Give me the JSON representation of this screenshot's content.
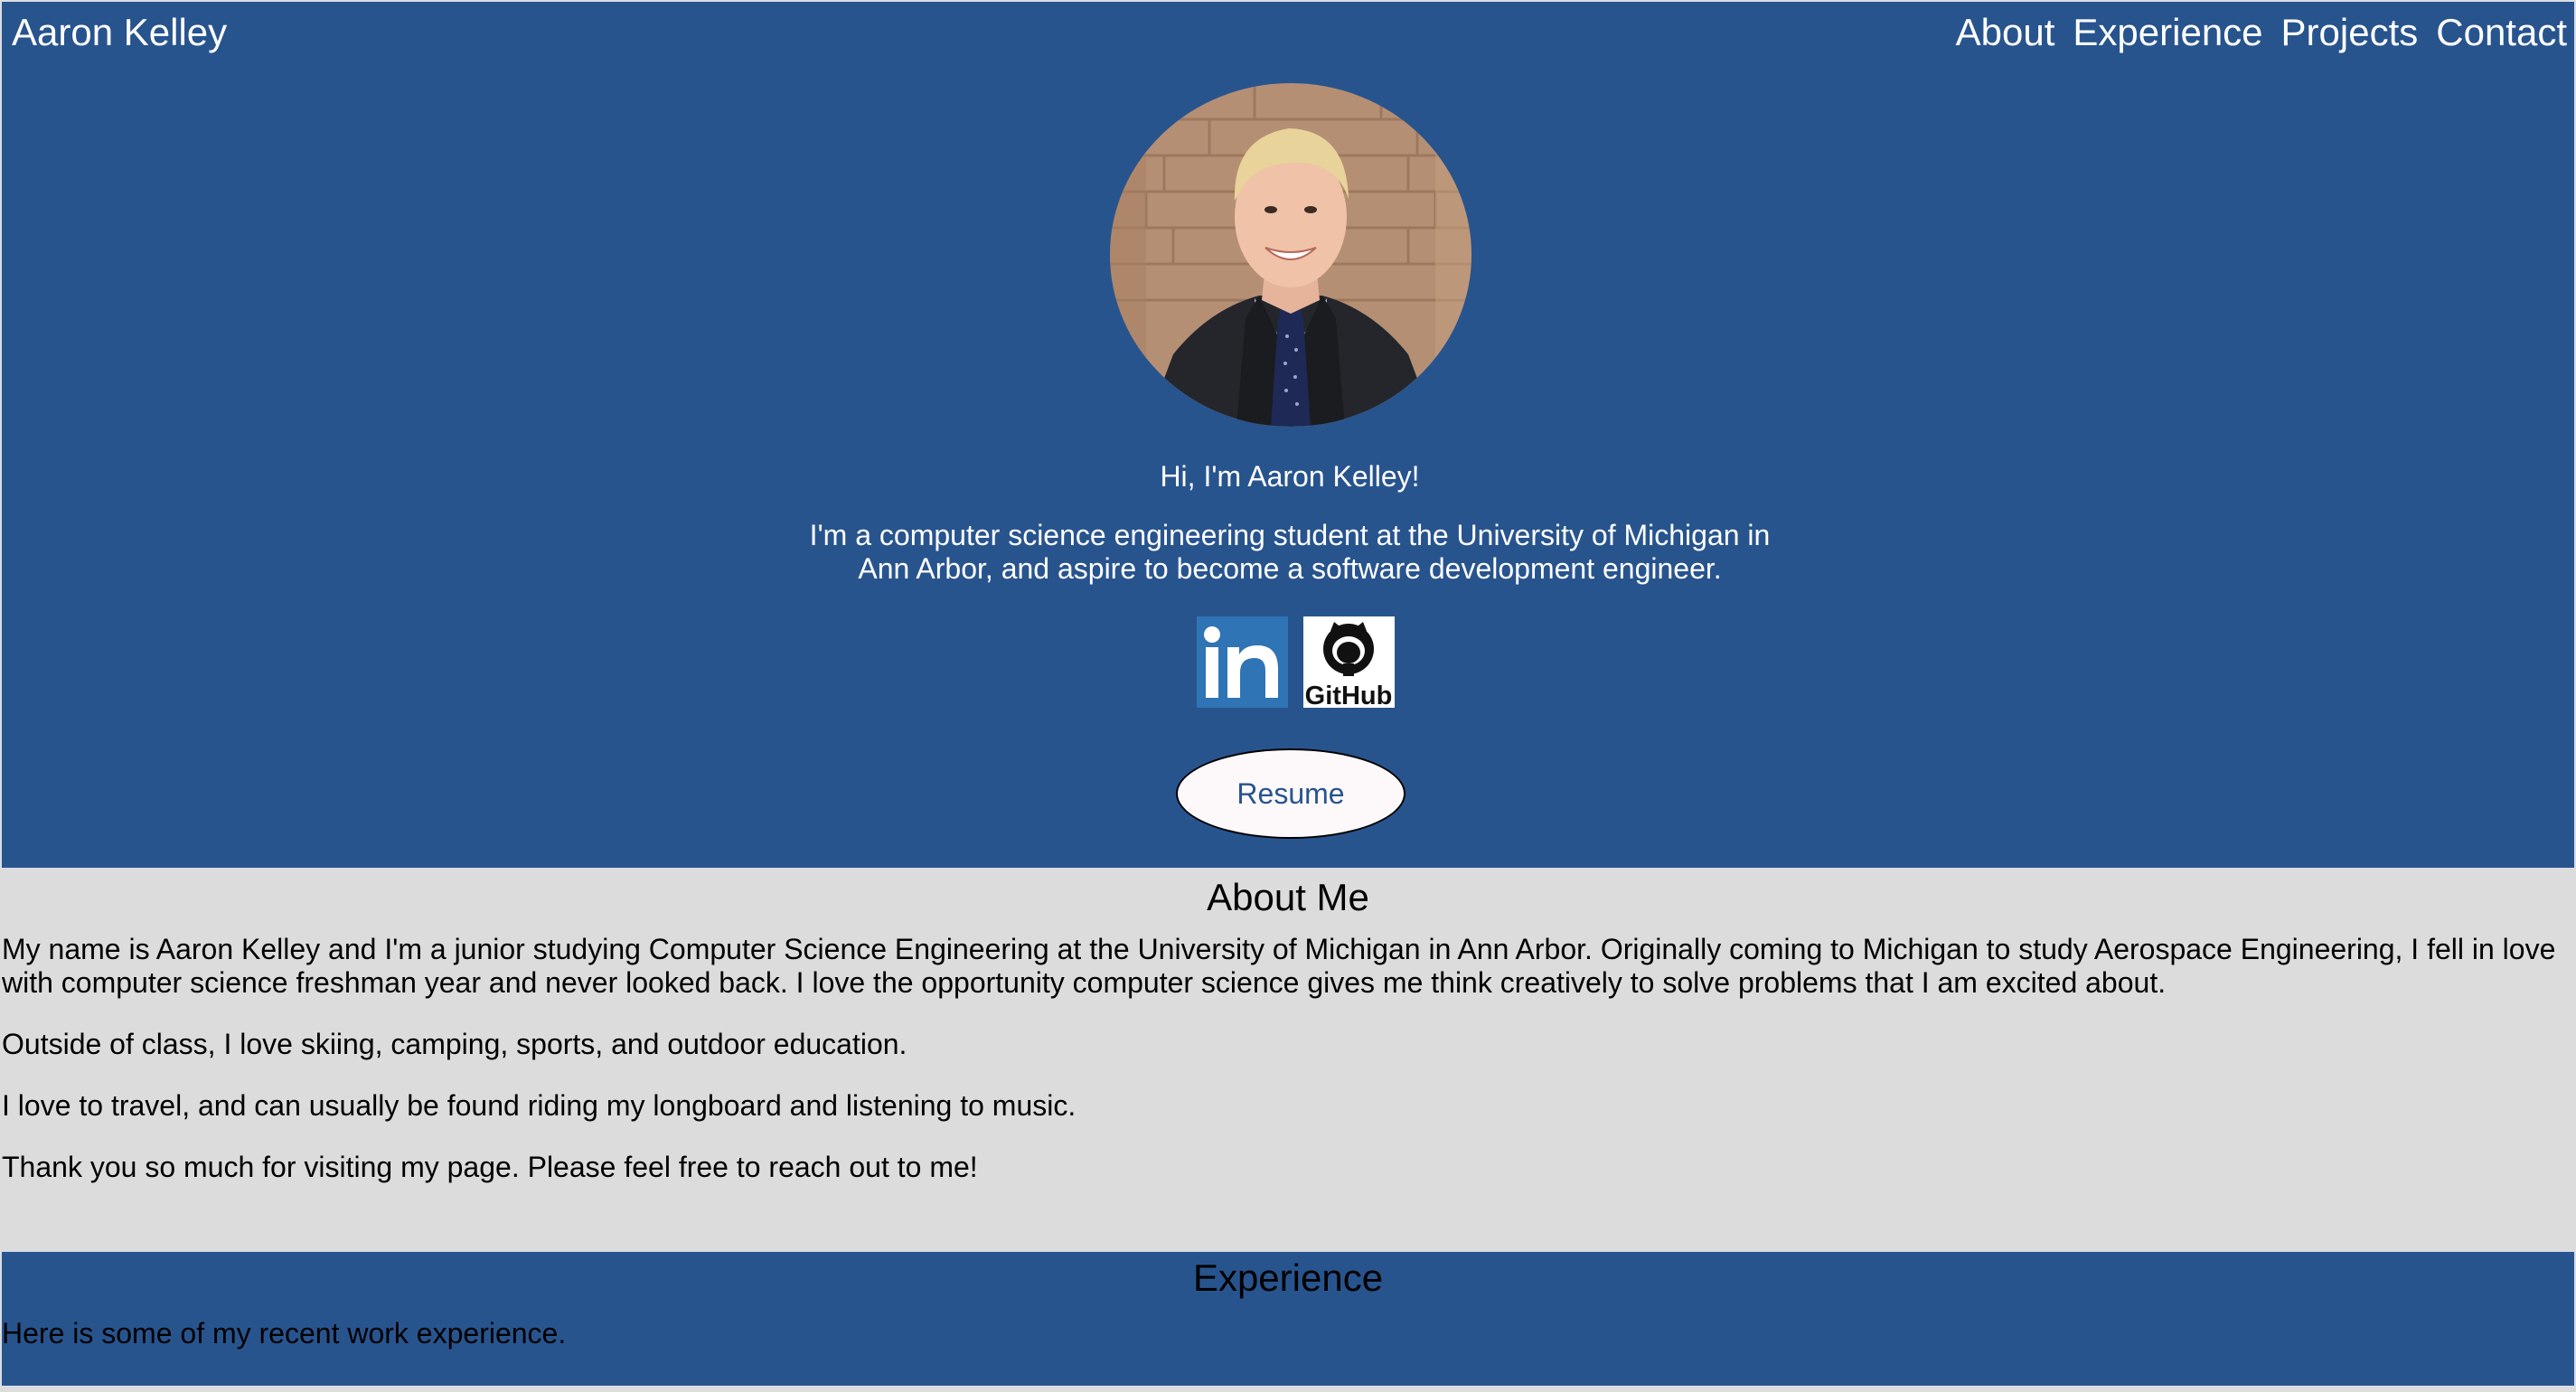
{
  "header": {
    "brand": "Aaron Kelley",
    "nav": [
      "About",
      "Experience",
      "Projects",
      "Contact"
    ]
  },
  "hero": {
    "greeting": "Hi, I'm Aaron Kelley!",
    "intro": "I'm a computer science engineering student at the University of Michigan in Ann Arbor, and aspire to become a software development engineer.",
    "social": [
      {
        "icon": "linkedin-icon",
        "text": "in"
      },
      {
        "icon": "github-icon",
        "text": "GitHub"
      }
    ],
    "resume_label": "Resume"
  },
  "about": {
    "title": "About Me",
    "paragraphs": [
      "My name is Aaron Kelley and I'm a junior studying Computer Science Engineering at the University of Michigan in Ann Arbor. Originally coming to Michigan to study Aerospace Engineering, I fell in love with computer science freshman year and never looked back. I love the opportunity computer science gives me think creatively to solve problems that I am excited about.",
      "Outside of class, I love skiing, camping, sports, and outdoor education.",
      "I love to travel, and can usually be found riding my longboard and listening to music.",
      "Thank you so much for visiting my page. Please feel free to reach out to me!"
    ]
  },
  "experience": {
    "title": "Experience",
    "text": "Here is some of my recent work experience."
  },
  "colors": {
    "primary": "#28548e",
    "about_bg": "#dcdcdc",
    "linkedin": "#2f74b5",
    "button_bg": "#fdf9fa"
  }
}
